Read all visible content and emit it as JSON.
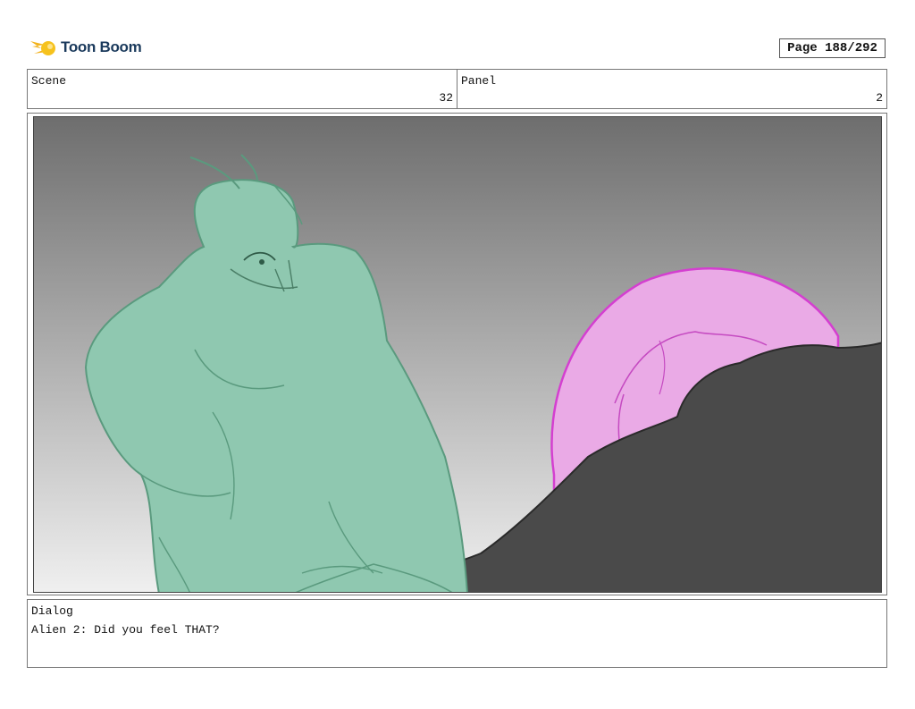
{
  "logo": {
    "text": "Toon Boom"
  },
  "page": {
    "label": "Page 188/292"
  },
  "scene": {
    "label": "Scene",
    "value": "32"
  },
  "panel": {
    "label": "Panel",
    "value": "2"
  },
  "dialog": {
    "label": "Dialog",
    "text": "Alien 2: Did you feel THAT?"
  },
  "colors": {
    "alien_skin": "#8fc8b0",
    "alien_outline": "#5a9a7e",
    "orb_fill": "#eaaae6",
    "orb_outline": "#d43fd0",
    "rock": "#4a4a4a",
    "sky_top": "#6e6e6e",
    "sky_bottom": "#f0f0f0"
  }
}
